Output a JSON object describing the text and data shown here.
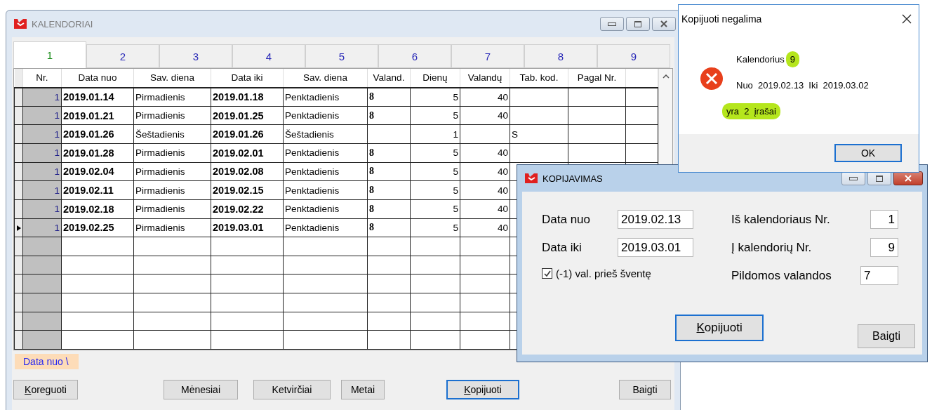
{
  "main_window": {
    "title": "KALENDORIAI",
    "tabs": [
      {
        "label": "1",
        "selected": true
      },
      {
        "label": "2",
        "selected": false
      },
      {
        "label": "3",
        "selected": false
      },
      {
        "label": "4",
        "selected": false
      },
      {
        "label": "5",
        "selected": false
      },
      {
        "label": "6",
        "selected": false
      },
      {
        "label": "7",
        "selected": false
      },
      {
        "label": "8",
        "selected": false
      },
      {
        "label": "9",
        "selected": false
      }
    ],
    "table": {
      "columns": [
        "Nr.",
        "Data nuo",
        "Sav. diena",
        "Data iki",
        "Sav. diena",
        "Valand.",
        "Dienų",
        "Valandų",
        "Tab. kod.",
        "Pagal Nr."
      ],
      "rows": [
        {
          "nr": "1",
          "data_nuo": "2019.01.14",
          "sav_diena_nuo": "Pirmadienis",
          "data_iki": "2019.01.18",
          "sav_diena_iki": "Penktadienis",
          "valand": "8",
          "dienu": "5",
          "valandu": "40",
          "current": false
        },
        {
          "nr": "1",
          "data_nuo": "2019.01.21",
          "sav_diena_nuo": "Pirmadienis",
          "data_iki": "2019.01.25",
          "sav_diena_iki": "Penktadienis",
          "valand": "8",
          "dienu": "5",
          "valandu": "40",
          "current": false
        },
        {
          "nr": "1",
          "data_nuo": "2019.01.26",
          "sav_diena_nuo": "Šeštadienis",
          "data_iki": "2019.01.26",
          "sav_diena_iki": "Šeštadienis",
          "dienu": "1",
          "tab_kod": "S",
          "current": false
        },
        {
          "nr": "1",
          "data_nuo": "2019.01.28",
          "sav_diena_nuo": "Pirmadienis",
          "data_iki": "2019.02.01",
          "sav_diena_iki": "Penktadienis",
          "valand": "8",
          "dienu": "5",
          "valandu": "40",
          "current": false
        },
        {
          "nr": "1",
          "data_nuo": "2019.02.04",
          "sav_diena_nuo": "Pirmadienis",
          "data_iki": "2019.02.08",
          "sav_diena_iki": "Penktadienis",
          "valand": "8",
          "dienu": "5",
          "valandu": "40",
          "current": false
        },
        {
          "nr": "1",
          "data_nuo": "2019.02.11",
          "sav_diena_nuo": "Pirmadienis",
          "data_iki": "2019.02.15",
          "sav_diena_iki": "Penktadienis",
          "valand": "8",
          "dienu": "5",
          "valandu": "40",
          "current": false
        },
        {
          "nr": "1",
          "data_nuo": "2019.02.18",
          "sav_diena_nuo": "Pirmadienis",
          "data_iki": "2019.02.22",
          "sav_diena_iki": "Penktadienis",
          "valand": "8",
          "dienu": "5",
          "valandu": "40",
          "current": false
        },
        {
          "nr": "1",
          "data_nuo": "2019.02.25",
          "sav_diena_nuo": "Pirmadienis",
          "data_iki": "2019.03.01",
          "sav_diena_iki": "Penktadienis",
          "valand": "8",
          "dienu": "5",
          "valandu": "40",
          "current": true
        }
      ]
    },
    "sort_hint": "Data nuo \\",
    "buttons": [
      {
        "label": "Koreguoti",
        "access_key_first": true,
        "default": false
      },
      {
        "label": "Mėnesiai",
        "access_key_first": false,
        "default": false
      },
      {
        "label": "Ketvirčiai",
        "access_key_first": false,
        "default": false
      },
      {
        "label": "Metai",
        "access_key_first": false,
        "default": false
      },
      {
        "label": "Kopijuoti",
        "access_key_first": true,
        "default": true
      },
      {
        "label": "Baigti",
        "access_key_first": false,
        "default": false
      }
    ]
  },
  "copy_dialog": {
    "title": "KOPIJAVIMAS",
    "left_fields": [
      {
        "label": "Data nuo",
        "value": "2019.02.13"
      },
      {
        "label": "Data iki",
        "value": "2019.03.01"
      }
    ],
    "checkbox": {
      "label": "(-1) val. prieš šventę",
      "checked": true
    },
    "right_fields": [
      {
        "label": "Iš kalendoriaus Nr.",
        "value": "1"
      },
      {
        "label": "Į kalendorių Nr.",
        "value": "9"
      },
      {
        "label": "Pildomos valandos",
        "value": "7"
      }
    ],
    "buttons": [
      {
        "label": "Kopijuoti",
        "access_key_first": true,
        "default": true
      },
      {
        "label": "Baigti",
        "access_key_first": false,
        "default": false
      }
    ]
  },
  "error_dialog": {
    "title": "Kopijuoti negalima",
    "lines": [
      [
        {
          "text": "Kalendorius",
          "highlighted": false
        },
        {
          "text": "9",
          "highlighted": true
        }
      ],
      [
        {
          "text": "Nuo  2019.02.13  Iki  2019.03.02",
          "highlighted": false
        }
      ],
      [
        {
          "text": "yra  2  įrašai",
          "highlighted": true
        }
      ]
    ],
    "button": "OK"
  }
}
